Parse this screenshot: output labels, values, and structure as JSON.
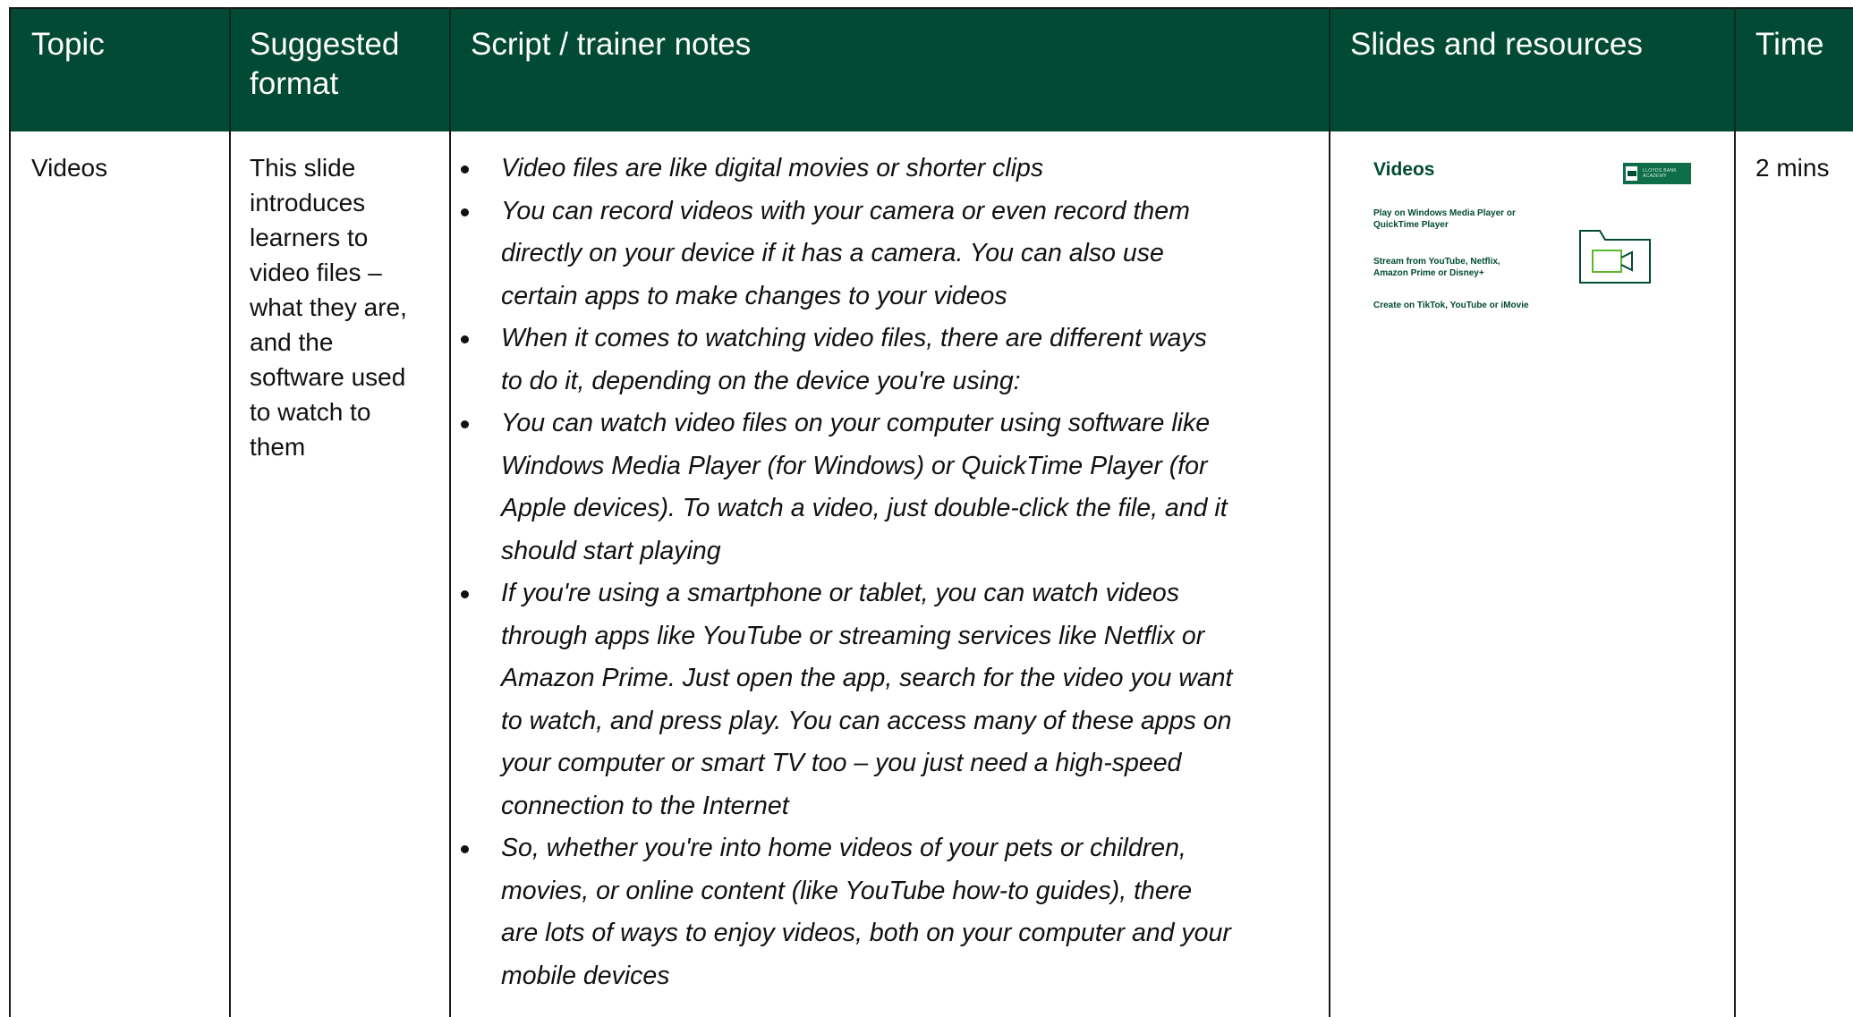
{
  "table": {
    "headers": {
      "topic": "Topic",
      "format": "Suggested format",
      "script": "Script / trainer notes",
      "slides": "Slides and resources",
      "time": "Time"
    },
    "row": {
      "topic": "Videos",
      "format_lines": [
        "This slide",
        "introduces",
        "learners to",
        "video files –",
        "what they are,",
        "and the",
        "software used",
        "to watch to",
        "them"
      ],
      "notes": [
        {
          "lines": [
            "Video files are like digital movies or shorter clips"
          ]
        },
        {
          "lines": [
            "You can record videos with your camera or even record them",
            "directly on your device if it has a camera. You can also use",
            "certain apps to make changes to your videos"
          ]
        },
        {
          "lines": [
            "When it comes to watching video files, there are different ways",
            "to do it, depending on the device you're using:"
          ]
        },
        {
          "lines": [
            "You can watch video files on your computer using software like",
            "Windows Media Player (for Windows) or QuickTime Player (for",
            "Apple devices). To watch a video, just double-click the file, and it",
            "should start playing"
          ]
        },
        {
          "lines": [
            "If you're using a smartphone or tablet, you can watch videos",
            "through apps like YouTube or streaming services like Netflix or",
            "Amazon Prime. Just open the app, search for the video you want",
            "to watch, and press play. You can access many of these apps on",
            "your computer or smart TV too – you just need a high-speed",
            "connection to the Internet"
          ]
        },
        {
          "lines": [
            "So, whether you're into home videos of your pets or children,",
            "movies, or online content (like YouTube how-to guides), there",
            "are lots of ways to enjoy videos, both on your computer and your",
            "mobile devices"
          ]
        }
      ],
      "slide": {
        "title": "Videos",
        "logo_text": "LLOYDS BANK ACADEMY",
        "line1a": "Play on Windows Media Player or",
        "line1b": "QuickTime Player",
        "line2a": "Stream from YouTube, Netflix,",
        "line2b": "Amazon Prime or Disney+",
        "line3": "Create on TikTok, YouTube or iMovie",
        "icon": "video-folder-icon"
      },
      "time": "2 mins"
    }
  },
  "colors": {
    "header_bg": "#024a33",
    "header_text": "#ffffff",
    "slide_accent": "#024a33",
    "icon_green": "#5cb82e"
  }
}
